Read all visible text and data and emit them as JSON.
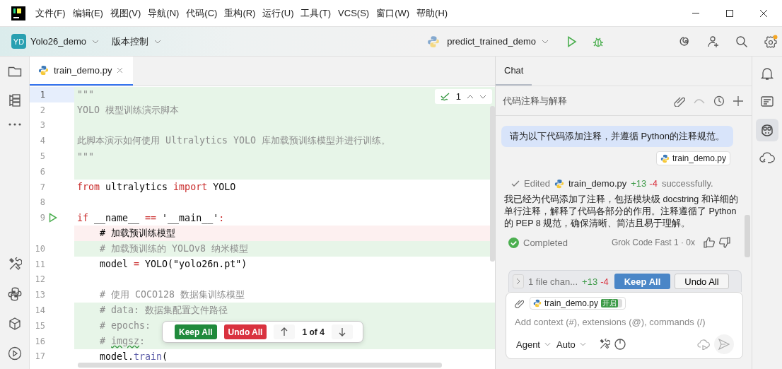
{
  "menu": [
    "文件(F)",
    "编辑(E)",
    "视图(V)",
    "导航(N)",
    "代码(C)",
    "重构(R)",
    "运行(U)",
    "工具(T)",
    "VCS(S)",
    "窗口(W)",
    "帮助(H)"
  ],
  "project": {
    "badge": "YD",
    "name": "Yolo26_demo"
  },
  "vcs_menu": "版本控制",
  "run_config": "predict_trained_demo",
  "left_tools": [
    {
      "kind": "folder"
    },
    {
      "kind": "structure"
    },
    {
      "kind": "more"
    },
    {
      "kind": "tools"
    },
    {
      "kind": "python"
    },
    {
      "kind": "packages"
    },
    {
      "kind": "run"
    }
  ],
  "editor": {
    "tab": {
      "label": "train_demo.py",
      "selected": true
    },
    "inspection_count": "1",
    "lines": [
      {
        "number": "1",
        "kind": "added",
        "current": true,
        "run": false,
        "segments": [
          {
            "kind": "doc",
            "text": "\"\"\""
          }
        ]
      },
      {
        "number": "2",
        "kind": "added",
        "current": false,
        "run": false,
        "segments": [
          {
            "kind": "doc",
            "text": "YOLO 模型训练演示脚本"
          }
        ]
      },
      {
        "number": "3",
        "kind": "added",
        "current": false,
        "run": false
      },
      {
        "number": "4",
        "kind": "added",
        "current": false,
        "run": false,
        "segments": [
          {
            "kind": "doc",
            "text": "此脚本演示如何使用 Ultralytics YOLO 库加载预训练模型并进行训练。"
          }
        ]
      },
      {
        "number": "5",
        "kind": "added",
        "current": false,
        "run": false,
        "segments": [
          {
            "kind": "doc",
            "text": "\"\"\""
          }
        ]
      },
      {
        "number": "6",
        "kind": "added",
        "current": false,
        "run": false
      },
      {
        "number": "7",
        "kind": "plain",
        "current": false,
        "run": false,
        "segments": [
          {
            "kind": "keyword",
            "text": "from"
          },
          {
            "kind": "plain",
            "text": " ultralytics "
          },
          {
            "kind": "keyword",
            "text": "import"
          },
          {
            "kind": "plain",
            "text": " YOLO"
          }
        ]
      },
      {
        "number": "8",
        "kind": "plain",
        "current": false,
        "run": false
      },
      {
        "number": "9",
        "kind": "plain",
        "current": false,
        "run": true,
        "segments": [
          {
            "kind": "keyword",
            "text": "if"
          },
          {
            "kind": "plain",
            "text": " __name__ "
          },
          {
            "kind": "keyword",
            "text": "=="
          },
          {
            "kind": "plain",
            "text": " '__main__'"
          },
          {
            "kind": "keyword",
            "text": ":"
          }
        ]
      },
      {
        "kind": "deleted",
        "current": false,
        "run": false,
        "segments": [
          {
            "kind": "plain",
            "text": "    # 加载预训练模型"
          }
        ]
      },
      {
        "number": "10",
        "kind": "added",
        "current": false,
        "run": false,
        "segments": [
          {
            "kind": "comment",
            "text": "    # 加载预训练的 YOLOv8 纳米模型"
          }
        ]
      },
      {
        "number": "11",
        "kind": "plain",
        "current": false,
        "run": false,
        "segments": [
          {
            "kind": "plain",
            "text": "    model "
          },
          {
            "kind": "keyword",
            "text": "="
          },
          {
            "kind": "plain",
            "text": " YOLO(\"yolo26n.pt\")"
          }
        ]
      },
      {
        "number": "12",
        "kind": "plain",
        "current": false,
        "run": false
      },
      {
        "number": "13",
        "kind": "plain",
        "current": false,
        "run": false,
        "segments": [
          {
            "kind": "comment",
            "text": "    # 使用 COCO128 数据集训练模型"
          }
        ]
      },
      {
        "number": "14",
        "kind": "added",
        "current": false,
        "run": false,
        "segments": [
          {
            "kind": "comment",
            "text": "    # data: 数据集配置文件路径"
          }
        ]
      },
      {
        "number": "15",
        "kind": "added",
        "current": false,
        "run": false,
        "segments": [
          {
            "kind": "comment",
            "text": "    # epochs:"
          }
        ]
      },
      {
        "number": "16",
        "kind": "added",
        "current": false,
        "run": false,
        "segments": [
          {
            "kind": "comment",
            "text": "    # "
          },
          {
            "kind": "typo",
            "text": "imgsz"
          },
          {
            "kind": "comment",
            "text": ":"
          }
        ]
      },
      {
        "number": "17",
        "kind": "plain",
        "current": false,
        "run": false,
        "segments": [
          {
            "kind": "plain",
            "text": "    model."
          },
          {
            "kind": "call",
            "text": "train"
          },
          {
            "kind": "plain",
            "text": "("
          }
        ]
      }
    ]
  },
  "diff_toolbar": {
    "keep": "Keep All",
    "undo": "Undo All",
    "position": "1 of 4"
  },
  "chat": {
    "tab": {
      "label": "Chat",
      "selected": true
    },
    "session_title": "代码注释与解释",
    "user_message": "请为以下代码添加注释，并遵循 Python的注释规范。",
    "attachment": "train_demo.py",
    "edit_status": {
      "prefix": "Edited",
      "file": "train_demo.py",
      "added": "+13",
      "removed": "-4",
      "suffix": "successfully."
    },
    "reply": "我已经为代码添加了注释，包括模块级 docstring 和详细的单行注释，解释了代码各部分的作用。注释遵循了 Python 的 PEP 8 规范，确保清晰、简洁且易于理解。",
    "status": "Completed",
    "model_info": "Grok Code Fast 1 · 0x",
    "changes_bar": {
      "summary": "1 file chan...",
      "added": "+13",
      "removed": "-4",
      "keep": "Keep All",
      "undo": "Undo All"
    },
    "input": {
      "context_file": "train_demo.py",
      "context_badge": "开启",
      "context_on": true,
      "placeholder": "Add context (#), extensions (@), commands (/)",
      "mode": "Agent",
      "model": "Auto"
    }
  },
  "right_tools": [
    {
      "kind": "bell",
      "selected": false
    },
    {
      "kind": "ai-list",
      "selected": false
    },
    {
      "kind": "copilot",
      "selected": true
    },
    {
      "kind": "cloud",
      "selected": false
    }
  ]
}
